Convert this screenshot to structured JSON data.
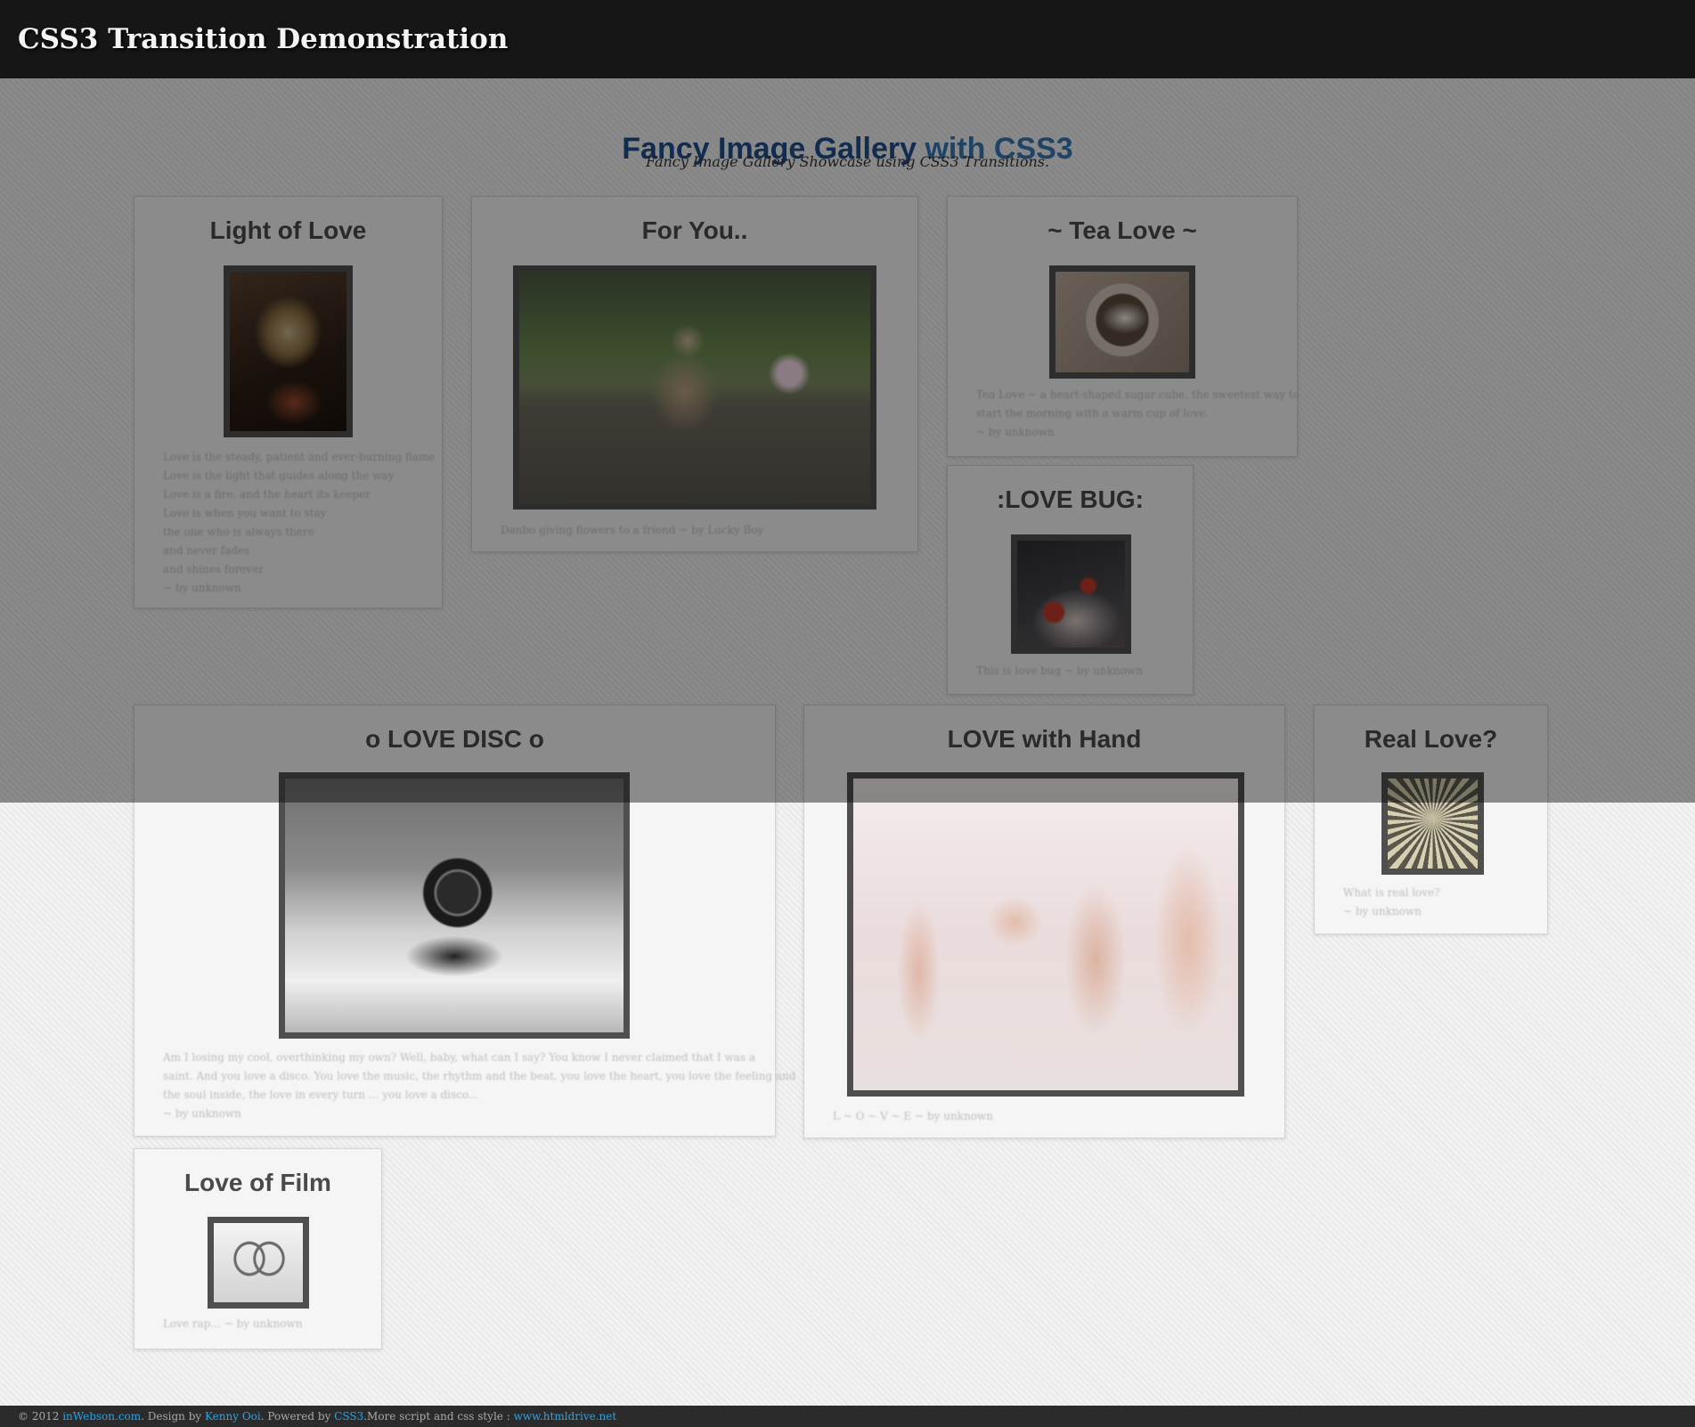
{
  "header": {
    "title": "CSS3 Transition Demonstration"
  },
  "gallery": {
    "title_main": "Fancy Image Gallery",
    "title_accent": "with CSS3",
    "subtitle": "Fancy Image Gallery Showcase using CSS3 Transitions."
  },
  "cards": {
    "light_of_love": {
      "title": "Light of Love",
      "caption": [
        "Love is the steady, patient and ever-burning flame",
        "Love is the light that guides along the way",
        "Love is a fire, and the heart its keeper",
        "Love is when you want to stay",
        "the one who is always there",
        "and never fades",
        "and shines forever",
        "~ by unknown"
      ]
    },
    "for_you": {
      "title": "For You..",
      "caption": [
        "Danbo giving flowers to a friend ~ by Lucky Boy"
      ]
    },
    "tea_love": {
      "title": "~ Tea Love ~",
      "caption": [
        "Tea Love ~ a heart-shaped sugar cube, the sweetest way to",
        "start the morning with a warm cup of love.",
        "~ by unknown"
      ]
    },
    "love_bug": {
      "title": ":LOVE BUG:",
      "caption": [
        "This is love bug ~ by unknown"
      ]
    },
    "love_disc": {
      "title": "o LOVE DISC o",
      "caption": [
        "Am I losing my cool, overthinking my own? Well, baby, what can I say? You know I never claimed that I was a",
        "saint. And you love a disco. You love the music, the rhythm and the beat, you love the heart, you love the feeling and",
        "the soul inside, the love in every turn ... you love a disco...",
        "~ by unknown"
      ]
    },
    "love_hand": {
      "title": "LOVE with Hand",
      "caption": [
        "L ~ O ~ V ~ E ~ by unknown"
      ]
    },
    "real_love": {
      "title": "Real Love?",
      "caption": [
        "What is real love?",
        "~ by unknown"
      ]
    },
    "love_film": {
      "title": "Love of Film",
      "caption": [
        "Love rap... ~ by unknown"
      ]
    }
  },
  "footer": {
    "copyright": "© 2012",
    "site_link": "inWebson.com",
    "design_text": ". Design by",
    "designer_link": "Kenny Ooi",
    "powered_text": ". Powered by",
    "powered_link": "CSS3",
    "more_text": ".More script and css style :",
    "more_link": "www.htmldrive.net"
  },
  "colors": {
    "topbar": "#161616",
    "title_blue": "#1f4e8a",
    "title_accent": "#3677b6",
    "link": "#2aa3e6"
  }
}
